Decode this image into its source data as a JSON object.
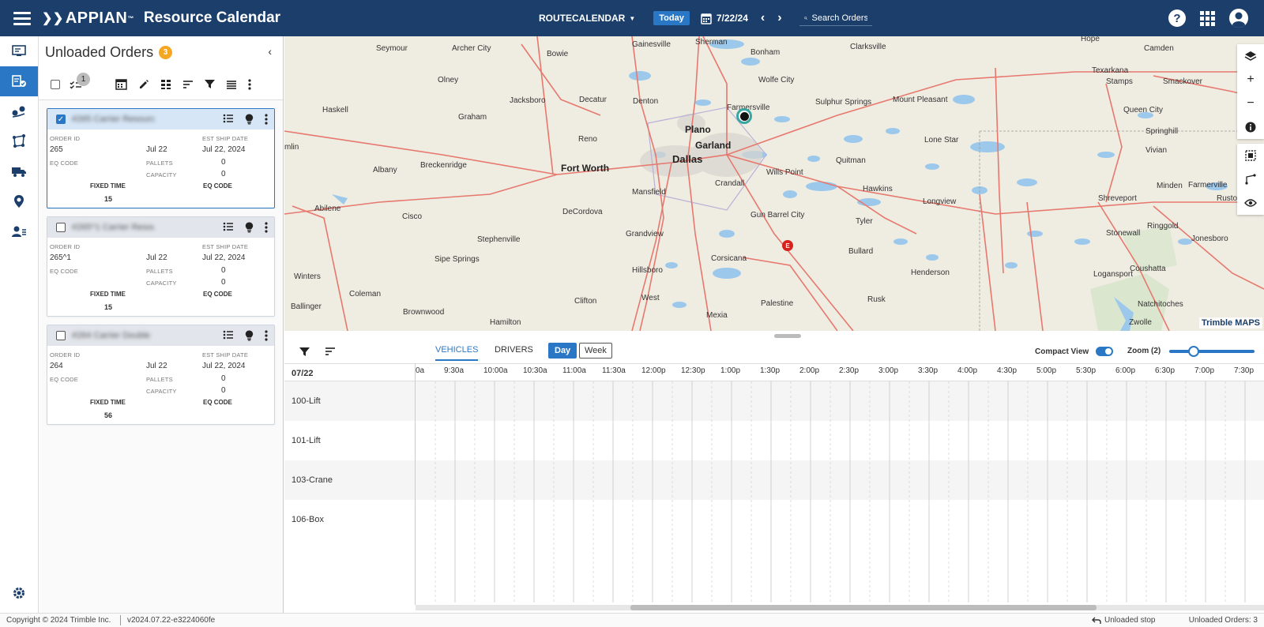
{
  "header": {
    "logo": "APPIAN",
    "logo_tm": "™",
    "title": "Resource Calendar",
    "calendar_select": "ROUTECALENDAR",
    "today_label": "Today",
    "date": "7/22/24",
    "search_placeholder": "Search Orders",
    "brand_color": "#1b3f6a",
    "accent_color": "#2a78c5"
  },
  "nav": {
    "items": [
      {
        "icon": "dispatch-board-icon"
      },
      {
        "icon": "unloaded-orders-icon",
        "active": true
      },
      {
        "icon": "routes-icon"
      },
      {
        "icon": "network-icon"
      },
      {
        "icon": "truck-icon"
      },
      {
        "icon": "location-pin-icon"
      },
      {
        "icon": "drivers-icon"
      }
    ],
    "settings_icon": "gear-icon"
  },
  "panel": {
    "title": "Unloaded Orders",
    "count": "3",
    "selected_count": "1",
    "cards": [
      {
        "name": "#265 Carrier Resource",
        "checked": true,
        "order_id_label": "ORDER ID",
        "order_id": "265",
        "date": "Jul 22",
        "ship_label": "EST SHIP DATE",
        "ship_date": "Jul 22, 2024",
        "eq_label": "EQ CODE",
        "pallets_label": "PALLETS",
        "pallets": "0",
        "capacity_label": "CAPACITY",
        "capacity": "0",
        "fixed_label": "FIXED TIME",
        "fixed": "15",
        "eq_code_label": "EQ CODE"
      },
      {
        "name": "#265^1 Carrier Resource",
        "checked": false,
        "order_id_label": "ORDER ID",
        "order_id": "265^1",
        "date": "Jul 22",
        "ship_label": "EST SHIP DATE",
        "ship_date": "Jul 22, 2024",
        "eq_label": "EQ CODE",
        "pallets_label": "PALLETS",
        "pallets": "0",
        "capacity_label": "CAPACITY",
        "capacity": "0",
        "fixed_label": "FIXED TIME",
        "fixed": "15",
        "eq_code_label": "EQ CODE"
      },
      {
        "name": "#264 Carrier Double",
        "checked": false,
        "order_id_label": "ORDER ID",
        "order_id": "264",
        "date": "Jul 22",
        "ship_label": "EST SHIP DATE",
        "ship_date": "Jul 22, 2024",
        "eq_label": "EQ CODE",
        "pallets_label": "PALLETS",
        "pallets": "0",
        "capacity_label": "CAPACITY",
        "capacity": "0",
        "fixed_label": "FIXED TIME",
        "fixed": "56",
        "eq_code_label": "EQ CODE"
      }
    ]
  },
  "map": {
    "cities": [
      {
        "name": "Sherman",
        "cls": ""
      },
      {
        "name": "Gainesville",
        "cls": ""
      },
      {
        "name": "Seymour",
        "cls": ""
      },
      {
        "name": "Archer City",
        "cls": ""
      },
      {
        "name": "Bowie",
        "cls": ""
      },
      {
        "name": "Bonham",
        "cls": ""
      },
      {
        "name": "Clarksville",
        "cls": ""
      },
      {
        "name": "Hope",
        "cls": ""
      },
      {
        "name": "Camden",
        "cls": ""
      },
      {
        "name": "Texarkana",
        "cls": ""
      },
      {
        "name": "Olney",
        "cls": ""
      },
      {
        "name": "Wolfe City",
        "cls": ""
      },
      {
        "name": "Stamps",
        "cls": ""
      },
      {
        "name": "Smackover",
        "cls": ""
      },
      {
        "name": "Jacksboro",
        "cls": ""
      },
      {
        "name": "Decatur",
        "cls": ""
      },
      {
        "name": "Denton",
        "cls": ""
      },
      {
        "name": "Farmersville",
        "cls": ""
      },
      {
        "name": "Sulphur Springs",
        "cls": ""
      },
      {
        "name": "Mount Pleasant",
        "cls": ""
      },
      {
        "name": "Queen City",
        "cls": ""
      },
      {
        "name": "Haskell",
        "cls": ""
      },
      {
        "name": "Graham",
        "cls": ""
      },
      {
        "name": "Plano",
        "cls": "major"
      },
      {
        "name": "Springhill",
        "cls": ""
      },
      {
        "name": "Garland",
        "cls": "major"
      },
      {
        "name": "Lone Star",
        "cls": ""
      },
      {
        "name": "Vivian",
        "cls": ""
      },
      {
        "name": "Farmerville",
        "cls": ""
      },
      {
        "name": "Albany",
        "cls": ""
      },
      {
        "name": "Breckenridge",
        "cls": ""
      },
      {
        "name": "Fort Worth",
        "cls": "major"
      },
      {
        "name": "Dallas",
        "cls": "big"
      },
      {
        "name": "Quitman",
        "cls": ""
      },
      {
        "name": "Wills Point",
        "cls": ""
      },
      {
        "name": "Crandall",
        "cls": ""
      },
      {
        "name": "Mansfield",
        "cls": ""
      },
      {
        "name": "Hawkins",
        "cls": ""
      },
      {
        "name": "Minden",
        "cls": ""
      },
      {
        "name": "Longview",
        "cls": ""
      },
      {
        "name": "Shreveport",
        "cls": ""
      },
      {
        "name": "Ruston",
        "cls": ""
      },
      {
        "name": "Abilene",
        "cls": ""
      },
      {
        "name": "Cisco",
        "cls": ""
      },
      {
        "name": "DeCordova",
        "cls": ""
      },
      {
        "name": "Gun Barrel City",
        "cls": ""
      },
      {
        "name": "Tyler",
        "cls": ""
      },
      {
        "name": "Stonewall",
        "cls": ""
      },
      {
        "name": "Ringgold",
        "cls": ""
      },
      {
        "name": "Jonesboro",
        "cls": ""
      },
      {
        "name": "Stephenville",
        "cls": ""
      },
      {
        "name": "Grandview",
        "cls": ""
      },
      {
        "name": "Bullard",
        "cls": ""
      },
      {
        "name": "Sipe Springs",
        "cls": ""
      },
      {
        "name": "Corsicana",
        "cls": ""
      },
      {
        "name": "Henderson",
        "cls": ""
      },
      {
        "name": "Hillsboro",
        "cls": ""
      },
      {
        "name": "Logansport",
        "cls": ""
      },
      {
        "name": "Coushatta",
        "cls": ""
      },
      {
        "name": "Winters",
        "cls": ""
      },
      {
        "name": "Coleman",
        "cls": ""
      },
      {
        "name": "West",
        "cls": ""
      },
      {
        "name": "Rusk",
        "cls": ""
      },
      {
        "name": "Clifton",
        "cls": ""
      },
      {
        "name": "Palestine",
        "cls": ""
      },
      {
        "name": "Natchitoches",
        "cls": ""
      },
      {
        "name": "Ballinger",
        "cls": ""
      },
      {
        "name": "Brownwood",
        "cls": ""
      },
      {
        "name": "Mexia",
        "cls": ""
      },
      {
        "name": "Hamilton",
        "cls": ""
      },
      {
        "name": "Zwolle",
        "cls": ""
      },
      {
        "name": "Reno",
        "cls": ""
      },
      {
        "name": "mlin",
        "cls": ""
      }
    ],
    "attribution": "Trimble MAPS",
    "end_marker": "E",
    "tools_top": [
      "layers-icon",
      "zoom-in-icon",
      "zoom-out-icon",
      "info-icon"
    ],
    "tools_bottom": [
      "box-select-icon",
      "route-draw-icon",
      "eye-icon"
    ]
  },
  "calendar": {
    "tabs": [
      {
        "label": "VEHICLES",
        "active": true
      },
      {
        "label": "DRIVERS",
        "active": false
      }
    ],
    "day_label": "Day",
    "week_label": "Week",
    "compact_label": "Compact View",
    "compact_on": true,
    "zoom_label": "Zoom (2)",
    "date": "07/22",
    "times": [
      "0a",
      "9:30a",
      "10:00a",
      "10:30a",
      "11:00a",
      "11:30a",
      "12:00p",
      "12:30p",
      "1:00p",
      "1:30p",
      "2:00p",
      "2:30p",
      "3:00p",
      "3:30p",
      "4:00p",
      "4:30p",
      "5:00p",
      "5:30p",
      "6:00p",
      "6:30p",
      "7:00p",
      "7:30p"
    ],
    "resources": [
      "100-Lift",
      "101-Lift",
      "103-Crane",
      "106-Box"
    ]
  },
  "footer": {
    "copyright": "Copyright © 2024 Trimble Inc.",
    "version": "v2024.07.22-e3224060fe",
    "unloaded_stop": "Unloaded stop",
    "unloaded_orders": "Unloaded Orders: 3"
  }
}
